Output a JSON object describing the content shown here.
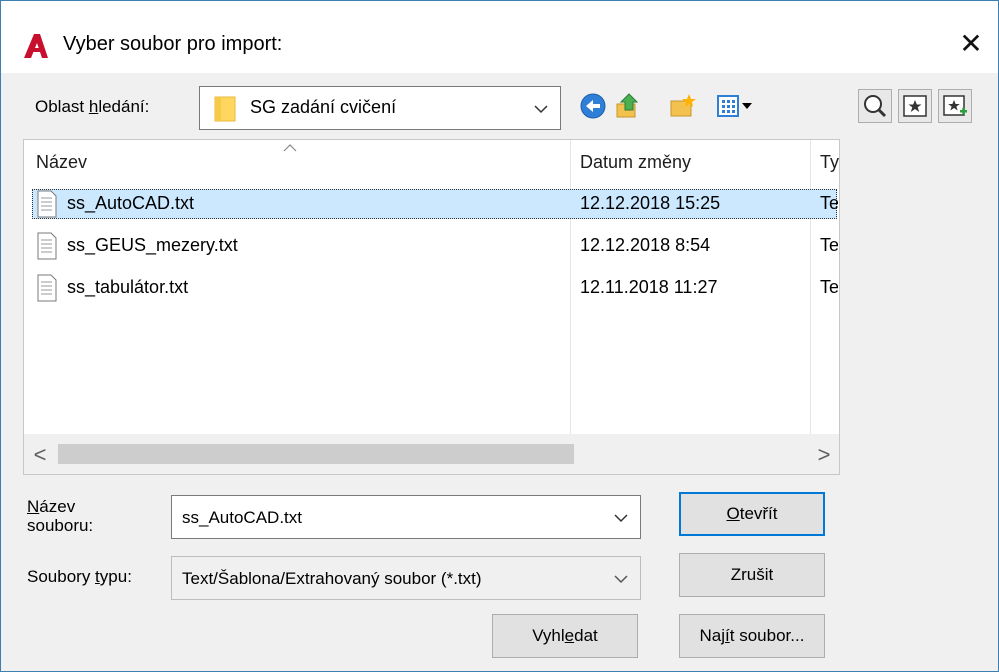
{
  "window": {
    "title": "Vyber soubor pro import:",
    "close_glyph": "✕"
  },
  "lookin": {
    "label_pre": "Oblast ",
    "label_u": "h",
    "label_post": "ledání:",
    "value": "SG zadání cvičení"
  },
  "toolbar_icons": [
    "back-icon",
    "up-folder-icon",
    "new-folder-icon",
    "views-menu-icon"
  ],
  "right_tools": [
    "find-icon",
    "favorites-icon",
    "add-favorite-icon"
  ],
  "list": {
    "columns": [
      "Název",
      "Datum změny",
      "Ty"
    ],
    "rows": [
      {
        "name": "ss_AutoCAD.txt",
        "date": "12.12.2018 15:25",
        "type": "Te",
        "selected": true
      },
      {
        "name": "ss_GEUS_mezery.txt",
        "date": "12.12.2018 8:54",
        "type": "Te",
        "selected": false
      },
      {
        "name": "ss_tabulátor.txt",
        "date": "12.11.2018 11:27",
        "type": "Te",
        "selected": false
      }
    ],
    "scroll_left": "<",
    "scroll_right": ">"
  },
  "filename": {
    "label_line1_u": "N",
    "label_line1_rest": "ázev",
    "label_line2": "souboru:",
    "value": "ss_AutoCAD.txt"
  },
  "filetype": {
    "label_pre": "Soubory ",
    "label_u": "t",
    "label_post": "ypu:",
    "value": "Text/Šablona/Extrahovaný soubor (*.txt)"
  },
  "buttons": {
    "open_u": "O",
    "open_rest": "tevřít",
    "cancel": "Zrušit",
    "search_pre": "Vyhl",
    "search_u": "e",
    "search_post": "dat",
    "find_pre": "Naj",
    "find_u": "í",
    "find_post": "t soubor..."
  },
  "colors": {
    "accent": "#0078d7",
    "selection": "#cce8ff",
    "brand_red": "#c8102e"
  }
}
